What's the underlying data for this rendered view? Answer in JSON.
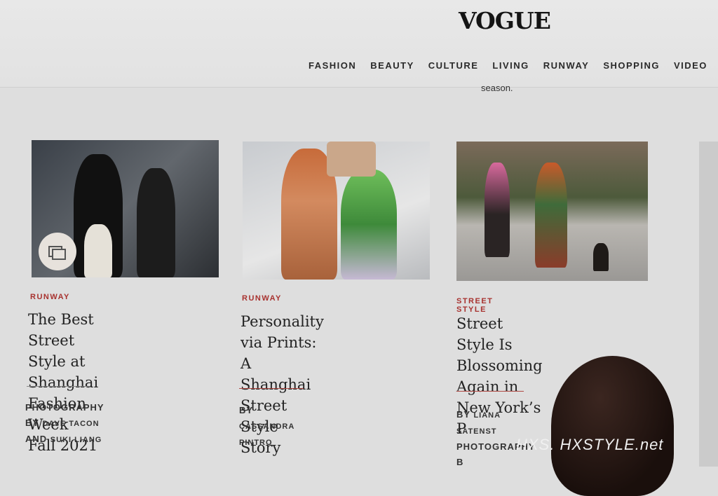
{
  "header": {
    "logo": "VOGUE"
  },
  "nav": {
    "items": [
      "FASHION",
      "BEAUTY",
      "CULTURE",
      "LIVING",
      "RUNWAY",
      "SHOPPING",
      "VIDEO"
    ]
  },
  "teaser_fragment": "season.",
  "cards": [
    {
      "category": "RUNWAY",
      "title_lines": [
        "The Best Street Style at",
        "Shanghai Fashion Week",
        "Fall 2021"
      ],
      "byline_lines": [
        {
          "prefix": "PHOTOGRAPHY BY",
          "name": "DAVE TACON"
        },
        {
          "prefix": "AND",
          "name": "SUKI LIANG"
        }
      ],
      "has_gallery_icon": true
    },
    {
      "category": "RUNWAY",
      "title_lines": [
        "Personality via Prints: A",
        "Shanghai Street Style",
        "Story"
      ],
      "byline_lines": [
        {
          "prefix": "BY",
          "name": "CASSANDRA PINTRO"
        }
      ]
    },
    {
      "category": "STREET STYLE",
      "title_lines": [
        "Street Style Is",
        "Blossoming Again in",
        "New York’s P"
      ],
      "byline_lines": [
        {
          "prefix": "BY",
          "name": "LIANA SATENST"
        },
        {
          "prefix": "PHOTOGRAPHY B",
          "name": ""
        }
      ]
    }
  ],
  "watermark": "HXS. HXSTYLE.net",
  "colors": {
    "category_red": "#a8322f",
    "background": "#dedede",
    "text": "#222222"
  }
}
